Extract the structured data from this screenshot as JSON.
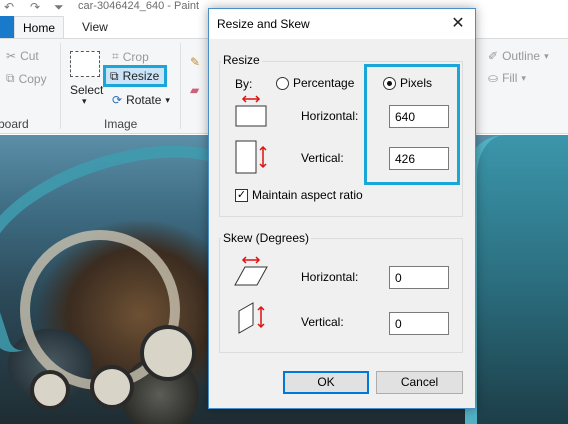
{
  "window": {
    "title": "car-3046424_640 - Paint",
    "qat_icons": [
      "undo-icon",
      "redo-icon",
      "customize-quick-access-icon"
    ]
  },
  "tabs": [
    {
      "label": "Home",
      "selected": true
    },
    {
      "label": "View",
      "selected": false
    }
  ],
  "ribbon": {
    "clipboard": {
      "cut": "Cut",
      "copy": "Copy",
      "group_label": "board"
    },
    "image": {
      "select": "Select",
      "crop": "Crop",
      "resize": "Resize",
      "rotate": "Rotate",
      "group_label": "Image"
    },
    "shapes": {
      "outline": "Outline",
      "fill": "Fill"
    },
    "highlight_color": "#1aa7d8"
  },
  "dialog": {
    "title": "Resize and Skew",
    "close_icon": "close-icon",
    "resize": {
      "group_label": "Resize",
      "by_label": "By:",
      "options": [
        {
          "label": "Percentage",
          "checked": false
        },
        {
          "label": "Pixels",
          "checked": true
        }
      ],
      "horizontal_label": "Horizontal:",
      "horizontal_value": "640",
      "vertical_label": "Vertical:",
      "vertical_value": "426",
      "maintain_aspect_label": "Maintain aspect ratio",
      "maintain_aspect_checked": true
    },
    "skew": {
      "group_label": "Skew (Degrees)",
      "horizontal_label": "Horizontal:",
      "horizontal_value": "0",
      "vertical_label": "Vertical:",
      "vertical_value": "0"
    },
    "ok_label": "OK",
    "cancel_label": "Cancel"
  }
}
